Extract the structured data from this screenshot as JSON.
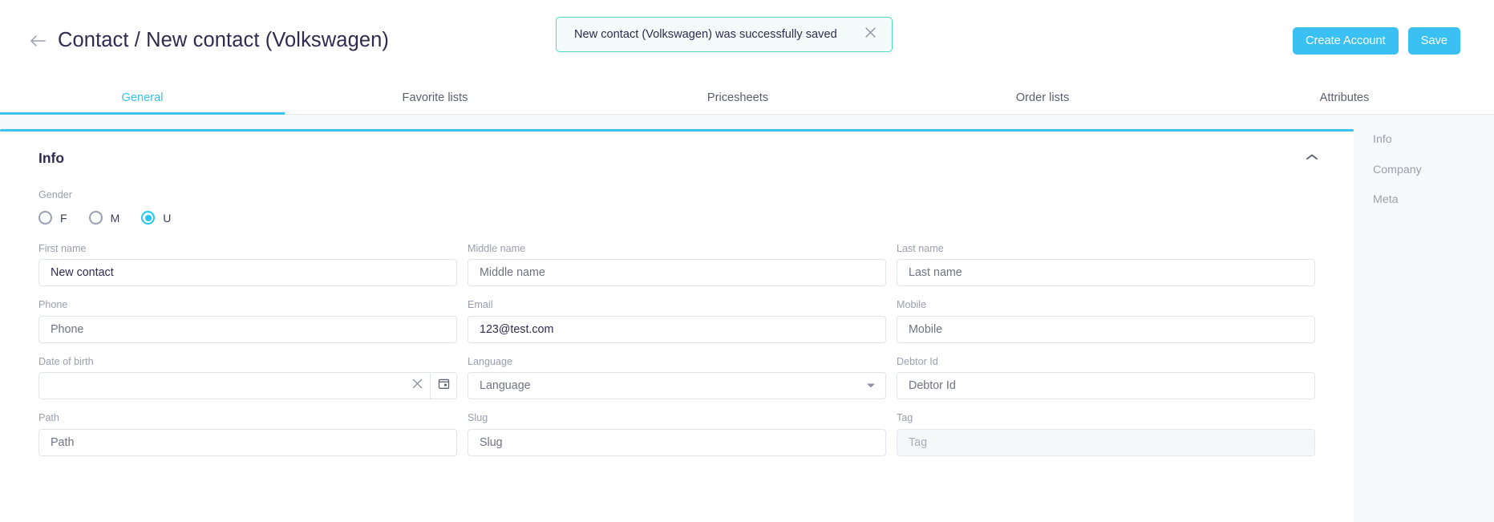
{
  "header": {
    "back_icon": "arrow-left-icon",
    "title": "Contact / New contact (Volkswagen)",
    "create_account_label": "Create Account",
    "save_label": "Save"
  },
  "toast": {
    "message": "New contact (Volkswagen) was successfully saved",
    "close_icon": "close-icon",
    "border_color": "#4ddbbd",
    "background_color": "#f3fcfa"
  },
  "tabs": {
    "active_index": 0,
    "accent_color": "#3ac0f2",
    "items": [
      {
        "label": "General"
      },
      {
        "label": "Favorite lists"
      },
      {
        "label": "Pricesheets"
      },
      {
        "label": "Order lists"
      },
      {
        "label": "Attributes"
      }
    ]
  },
  "card": {
    "title": "Info",
    "collapse_icon": "chevron-up-icon",
    "accent_color": "#3ac0f2"
  },
  "gender": {
    "label": "Gender",
    "selected": "U",
    "options": [
      {
        "label": "F",
        "checked": false
      },
      {
        "label": "M",
        "checked": false
      },
      {
        "label": "U",
        "checked": true
      }
    ]
  },
  "fields": {
    "first_name": {
      "label": "First name",
      "value": "New contact",
      "placeholder": "First name"
    },
    "middle_name": {
      "label": "Middle name",
      "value": "",
      "placeholder": "Middle name"
    },
    "last_name": {
      "label": "Last name",
      "value": "",
      "placeholder": "Last name"
    },
    "phone": {
      "label": "Phone",
      "value": "",
      "placeholder": "Phone"
    },
    "email": {
      "label": "Email",
      "value": "123@test.com",
      "placeholder": "Email"
    },
    "mobile": {
      "label": "Mobile",
      "value": "",
      "placeholder": "Mobile"
    },
    "date_of_birth": {
      "label": "Date of birth",
      "value": "",
      "placeholder": "",
      "clear_icon": "close-icon",
      "calendar_icon": "calendar-icon"
    },
    "language": {
      "label": "Language",
      "value": "",
      "placeholder": "Language",
      "caret_icon": "chevron-down-icon"
    },
    "debtor_id": {
      "label": "Debtor Id",
      "value": "",
      "placeholder": "Debtor Id"
    },
    "path": {
      "label": "Path",
      "value": "",
      "placeholder": "Path"
    },
    "slug": {
      "label": "Slug",
      "value": "",
      "placeholder": "Slug"
    },
    "tag": {
      "label": "Tag",
      "value": "",
      "placeholder": "Tag",
      "disabled": true
    }
  },
  "rightnav": {
    "items": [
      {
        "label": "Info"
      },
      {
        "label": "Company"
      },
      {
        "label": "Meta"
      }
    ]
  }
}
